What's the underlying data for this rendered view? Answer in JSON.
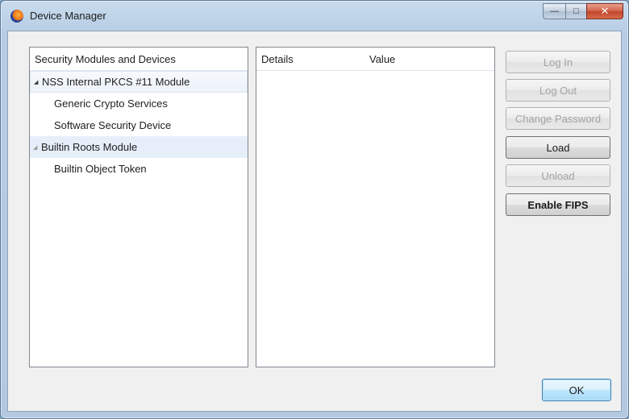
{
  "window": {
    "title": "Device Manager"
  },
  "tree": {
    "header": "Security Modules and Devices",
    "items": [
      {
        "label": "NSS Internal PKCS #11 Module",
        "level": 0,
        "expanded": true
      },
      {
        "label": "Generic Crypto Services",
        "level": 1
      },
      {
        "label": "Software Security Device",
        "level": 1
      },
      {
        "label": "Builtin Roots Module",
        "level": 0,
        "expanded": true
      },
      {
        "label": "Builtin Object Token",
        "level": 1
      }
    ]
  },
  "details": {
    "col_details": "Details",
    "col_value": "Value"
  },
  "buttons": {
    "log_in": "Log In",
    "log_out": "Log Out",
    "change_password": "Change Password",
    "load": "Load",
    "unload": "Unload",
    "enable_fips": "Enable FIPS",
    "ok": "OK"
  },
  "controls": {
    "minimize": "—",
    "maximize": "□",
    "close": "✕"
  }
}
